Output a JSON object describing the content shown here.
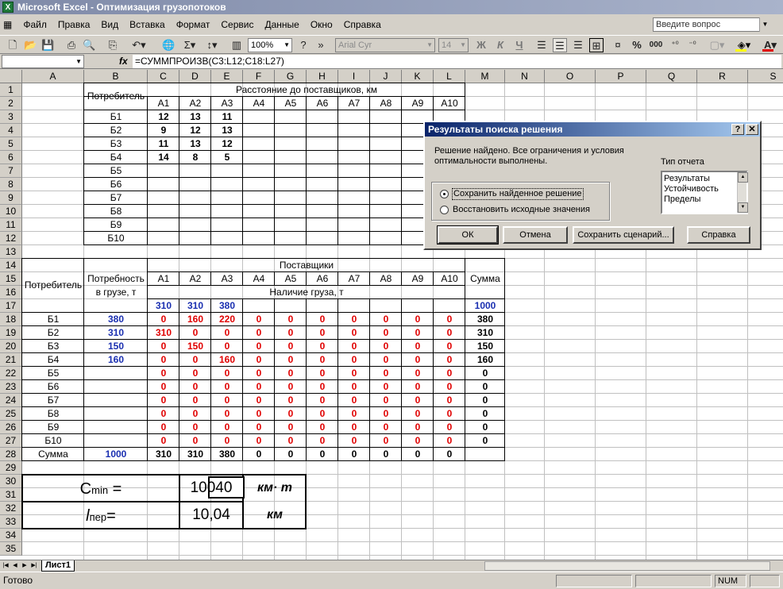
{
  "app": {
    "title": "Microsoft Excel - Оптимизация грузопотоков",
    "icon": "excel-icon"
  },
  "menu": [
    "Файл",
    "Правка",
    "Вид",
    "Вставка",
    "Формат",
    "Сервис",
    "Данные",
    "Окно",
    "Справка"
  ],
  "ask": {
    "placeholder": "Введите вопрос"
  },
  "toolbar": {
    "zoom": "100%",
    "font": "Arial Cyr",
    "size": "14",
    "bold": "Ж",
    "italic": "К",
    "underline": "Ч",
    "percent": "%",
    "thousands": "000"
  },
  "formula": {
    "name": "",
    "fx": "fx",
    "value": "=СУММПРОИЗВ(C3:L12;C18:L27)"
  },
  "columns": [
    "A",
    "B",
    "C",
    "D",
    "E",
    "F",
    "G",
    "H",
    "I",
    "J",
    "K",
    "L",
    "M",
    "N",
    "O",
    "P",
    "Q",
    "R",
    "S"
  ],
  "rows": [
    "1",
    "2",
    "3",
    "4",
    "5",
    "6",
    "7",
    "8",
    "9",
    "10",
    "11",
    "12",
    "13",
    "14",
    "15",
    "16",
    "17",
    "18",
    "19",
    "20",
    "21",
    "22",
    "23",
    "24",
    "25",
    "26",
    "27",
    "28",
    "29",
    "30",
    "31",
    "32",
    "33",
    "34",
    "35"
  ],
  "table1": {
    "consumer_header": "Потребитель",
    "distance_header": "Расстояние до поставщиков, км",
    "suppliers": [
      "А1",
      "А2",
      "А3",
      "А4",
      "А5",
      "А6",
      "А7",
      "А8",
      "А9",
      "А10"
    ],
    "consumers": [
      "Б1",
      "Б2",
      "Б3",
      "Б4",
      "Б5",
      "Б6",
      "Б7",
      "Б8",
      "Б9",
      "Б10"
    ],
    "distances": [
      [
        "12",
        "13",
        "11"
      ],
      [
        "9",
        "12",
        "13"
      ],
      [
        "11",
        "13",
        "12"
      ],
      [
        "14",
        "8",
        "5"
      ]
    ]
  },
  "table2": {
    "consumer_header": "Потребитель",
    "need_header_1": "Потребность",
    "need_header_2": "в грузе, т",
    "suppliers_header": "Поставщики",
    "sum_header": "Сумма",
    "availability_header": "Наличие груза, т",
    "availability": [
      "310",
      "310",
      "380"
    ],
    "availability_total": "1000",
    "needs": [
      "380",
      "310",
      "150",
      "160"
    ],
    "plan": [
      [
        "0",
        "160",
        "220",
        "0",
        "0",
        "0",
        "0",
        "0",
        "0",
        "0"
      ],
      [
        "310",
        "0",
        "0",
        "0",
        "0",
        "0",
        "0",
        "0",
        "0",
        "0"
      ],
      [
        "0",
        "150",
        "0",
        "0",
        "0",
        "0",
        "0",
        "0",
        "0",
        "0"
      ],
      [
        "0",
        "0",
        "160",
        "0",
        "0",
        "0",
        "0",
        "0",
        "0",
        "0"
      ],
      [
        "0",
        "0",
        "0",
        "0",
        "0",
        "0",
        "0",
        "0",
        "0",
        "0"
      ],
      [
        "0",
        "0",
        "0",
        "0",
        "0",
        "0",
        "0",
        "0",
        "0",
        "0"
      ],
      [
        "0",
        "0",
        "0",
        "0",
        "0",
        "0",
        "0",
        "0",
        "0",
        "0"
      ],
      [
        "0",
        "0",
        "0",
        "0",
        "0",
        "0",
        "0",
        "0",
        "0",
        "0"
      ],
      [
        "0",
        "0",
        "0",
        "0",
        "0",
        "0",
        "0",
        "0",
        "0",
        "0"
      ],
      [
        "0",
        "0",
        "0",
        "0",
        "0",
        "0",
        "0",
        "0",
        "0",
        "0"
      ]
    ],
    "row_sums": [
      "380",
      "310",
      "150",
      "160",
      "0",
      "0",
      "0",
      "0",
      "0",
      "0"
    ],
    "sum_label": "Сумма",
    "needs_total": "1000",
    "col_sums": [
      "310",
      "310",
      "380",
      "0",
      "0",
      "0",
      "0",
      "0",
      "0",
      "0"
    ]
  },
  "results": {
    "cmin_label": "C",
    "cmin_sub": "min",
    "cmin_eq": " =",
    "cmin_value": "10040",
    "cmin_unit": "км· т",
    "lper_label": "l",
    "lper_sub": "пер",
    "lper_eq": "=",
    "lper_value": "10,04",
    "lper_unit": "км"
  },
  "dialog": {
    "title": "Результаты поиска решения",
    "help_btn": "?",
    "close_btn": "✕",
    "message": "Решение найдено. Все ограничения и условия оптимальности выполнены.",
    "option_keep": "Сохранить найденное решение",
    "option_restore": "Восстановить исходные значения",
    "report_label": "Тип отчета",
    "reports": [
      "Результаты",
      "Устойчивость",
      "Пределы"
    ],
    "ok": "ОК",
    "cancel": "Отмена",
    "save_scenario": "Сохранить сценарий...",
    "help": "Справка"
  },
  "sheet": {
    "tab": "Лист1"
  },
  "status": {
    "text": "Готово",
    "num": "NUM"
  }
}
